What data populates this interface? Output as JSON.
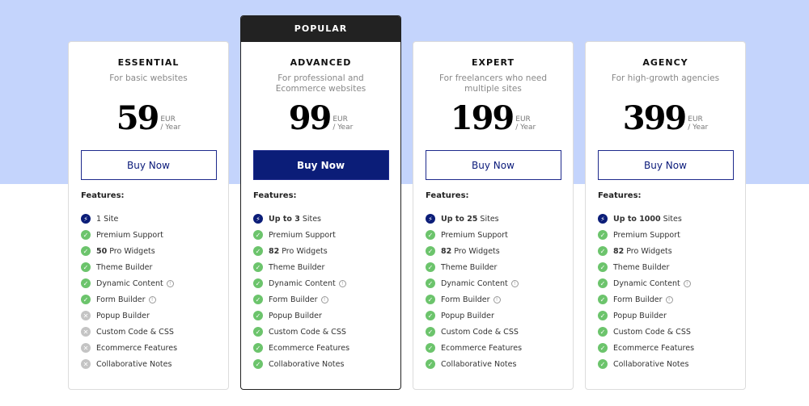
{
  "colors": {
    "background": "#c4d4fc",
    "accent": "#0b1d78",
    "check": "#6cc46c",
    "cross": "#c4c4c4"
  },
  "popular_label": "POPULAR",
  "features_label": "Features:",
  "plans": [
    {
      "name": "ESSENTIAL",
      "subtitle": "For basic websites",
      "price": "59",
      "currency": "EUR",
      "period": "/ Year",
      "button": "Buy Now",
      "popular": false,
      "features": [
        {
          "bold": "",
          "text": "1 Site",
          "status": "site"
        },
        {
          "bold": "",
          "text": "Premium Support",
          "status": "check"
        },
        {
          "bold": "50",
          "text": "Pro Widgets",
          "status": "check"
        },
        {
          "bold": "",
          "text": "Theme Builder",
          "status": "check"
        },
        {
          "bold": "",
          "text": "Dynamic Content",
          "status": "check",
          "info": true
        },
        {
          "bold": "",
          "text": "Form Builder",
          "status": "check",
          "info": true
        },
        {
          "bold": "",
          "text": "Popup Builder",
          "status": "cross"
        },
        {
          "bold": "",
          "text": "Custom Code & CSS",
          "status": "cross"
        },
        {
          "bold": "",
          "text": "Ecommerce Features",
          "status": "cross"
        },
        {
          "bold": "",
          "text": "Collaborative Notes",
          "status": "cross"
        }
      ]
    },
    {
      "name": "ADVANCED",
      "subtitle": "For professional and Ecommerce websites",
      "price": "99",
      "currency": "EUR",
      "period": "/ Year",
      "button": "Buy Now",
      "popular": true,
      "features": [
        {
          "bold": "Up to 3",
          "text": "Sites",
          "status": "site"
        },
        {
          "bold": "",
          "text": "Premium Support",
          "status": "check"
        },
        {
          "bold": "82",
          "text": "Pro Widgets",
          "status": "check"
        },
        {
          "bold": "",
          "text": "Theme Builder",
          "status": "check"
        },
        {
          "bold": "",
          "text": "Dynamic Content",
          "status": "check",
          "info": true
        },
        {
          "bold": "",
          "text": "Form Builder",
          "status": "check",
          "info": true
        },
        {
          "bold": "",
          "text": "Popup Builder",
          "status": "check"
        },
        {
          "bold": "",
          "text": "Custom Code & CSS",
          "status": "check"
        },
        {
          "bold": "",
          "text": "Ecommerce Features",
          "status": "check"
        },
        {
          "bold": "",
          "text": "Collaborative Notes",
          "status": "check"
        }
      ]
    },
    {
      "name": "EXPERT",
      "subtitle": "For freelancers who need multiple sites",
      "price": "199",
      "currency": "EUR",
      "period": "/ Year",
      "button": "Buy Now",
      "popular": false,
      "features": [
        {
          "bold": "Up to 25",
          "text": "Sites",
          "status": "site"
        },
        {
          "bold": "",
          "text": "Premium Support",
          "status": "check"
        },
        {
          "bold": "82",
          "text": "Pro Widgets",
          "status": "check"
        },
        {
          "bold": "",
          "text": "Theme Builder",
          "status": "check"
        },
        {
          "bold": "",
          "text": "Dynamic Content",
          "status": "check",
          "info": true
        },
        {
          "bold": "",
          "text": "Form Builder",
          "status": "check",
          "info": true
        },
        {
          "bold": "",
          "text": "Popup Builder",
          "status": "check"
        },
        {
          "bold": "",
          "text": "Custom Code & CSS",
          "status": "check"
        },
        {
          "bold": "",
          "text": "Ecommerce Features",
          "status": "check"
        },
        {
          "bold": "",
          "text": "Collaborative Notes",
          "status": "check"
        }
      ]
    },
    {
      "name": "AGENCY",
      "subtitle": "For high-growth agencies",
      "price": "399",
      "currency": "EUR",
      "period": "/ Year",
      "button": "Buy Now",
      "popular": false,
      "features": [
        {
          "bold": "Up to 1000",
          "text": "Sites",
          "status": "site"
        },
        {
          "bold": "",
          "text": "Premium Support",
          "status": "check"
        },
        {
          "bold": "82",
          "text": "Pro Widgets",
          "status": "check"
        },
        {
          "bold": "",
          "text": "Theme Builder",
          "status": "check"
        },
        {
          "bold": "",
          "text": "Dynamic Content",
          "status": "check",
          "info": true
        },
        {
          "bold": "",
          "text": "Form Builder",
          "status": "check",
          "info": true
        },
        {
          "bold": "",
          "text": "Popup Builder",
          "status": "check"
        },
        {
          "bold": "",
          "text": "Custom Code & CSS",
          "status": "check"
        },
        {
          "bold": "",
          "text": "Ecommerce Features",
          "status": "check"
        },
        {
          "bold": "",
          "text": "Collaborative Notes",
          "status": "check"
        }
      ]
    }
  ]
}
